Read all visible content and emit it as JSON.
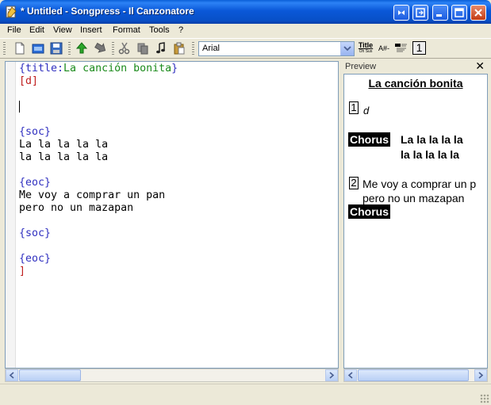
{
  "window": {
    "title": "* Untitled - Songpress - Il Canzonatore"
  },
  "menu": [
    "File",
    "Edit",
    "View",
    "Insert",
    "Format",
    "Tools",
    "?"
  ],
  "toolbar": {
    "font_value": "Arial",
    "icons": [
      "new-file-icon",
      "open-file-icon",
      "save-icon",
      "undo-icon",
      "redo-icon",
      "cut-icon",
      "copy-icon",
      "paste-chord-icon",
      "paste-icon",
      "title-style-icon",
      "chord-transpose-icon",
      "chorus-style-icon",
      "verse-number-icon"
    ],
    "title_btn_label": "Title",
    "title_btn_sub": "Oh Sus",
    "chord_btn_label": "A#-",
    "verse_btn_label": "1"
  },
  "editor": {
    "lines": [
      {
        "parts": [
          {
            "cls": "c-dir",
            "t": "{title:"
          },
          {
            "cls": "c-val",
            "t": "La canción bonita"
          },
          {
            "cls": "c-dir",
            "t": "}"
          }
        ]
      },
      {
        "parts": [
          {
            "cls": "c-chord",
            "t": "[d]"
          }
        ]
      },
      {
        "parts": []
      },
      {
        "parts": [],
        "caret": true
      },
      {
        "parts": []
      },
      {
        "parts": [
          {
            "cls": "c-dir",
            "t": "{soc}"
          }
        ]
      },
      {
        "parts": [
          {
            "cls": "c-text",
            "t": "La la la la la"
          }
        ]
      },
      {
        "parts": [
          {
            "cls": "c-text",
            "t": "la la la la la"
          }
        ]
      },
      {
        "parts": []
      },
      {
        "parts": [
          {
            "cls": "c-dir",
            "t": "{eoc}"
          }
        ]
      },
      {
        "parts": [
          {
            "cls": "c-text",
            "t": "Me voy a comprar un pan"
          }
        ]
      },
      {
        "parts": [
          {
            "cls": "c-text",
            "t": "pero no un mazapan"
          }
        ]
      },
      {
        "parts": []
      },
      {
        "parts": [
          {
            "cls": "c-dir",
            "t": "{soc}"
          }
        ]
      },
      {
        "parts": []
      },
      {
        "parts": [
          {
            "cls": "c-dir",
            "t": "{eoc}"
          }
        ]
      },
      {
        "parts": [
          {
            "cls": "c-chord",
            "t": "]"
          }
        ]
      }
    ]
  },
  "preview": {
    "header": "Preview",
    "title": "La canción bonita",
    "verse1_num": "1",
    "verse1_chord": "d",
    "chorus_label": "Chorus",
    "chorus_line1": "La la la la la",
    "chorus_line2": "la la la la la",
    "verse2_num": "2",
    "verse2_line1": "Me voy a comprar un p",
    "verse2_line2": "pero no un mazapan",
    "chorus2_label": "Chorus"
  },
  "colors": {
    "directive": "#3030c0",
    "value": "#1a8a1a",
    "chord": "#c02020",
    "titlebar": "#0a58d8"
  }
}
